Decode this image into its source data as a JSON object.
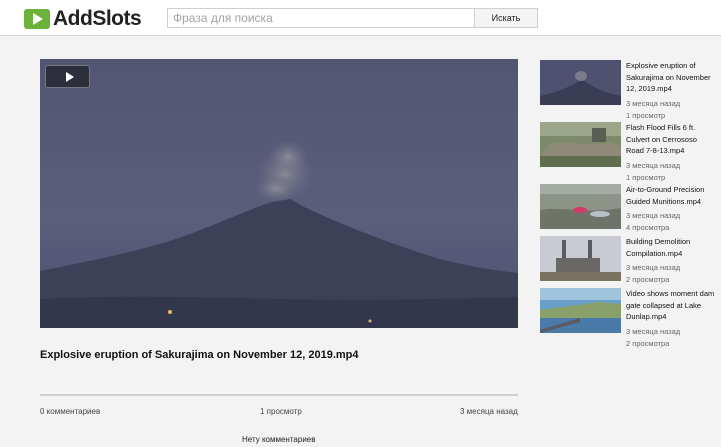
{
  "header": {
    "logo_text": "AddSlots",
    "search_placeholder": "Фраза для поиска",
    "search_button": "Искать"
  },
  "video": {
    "title": "Explosive eruption of Sakurajima on November 12, 2019.mp4",
    "comments": "0 комментариев",
    "views": "1 просмотр",
    "date": "3 месяца назад",
    "no_comments": "Нету комментариев"
  },
  "related": [
    {
      "title": "Explosive eruption of Sakurajima on November 12, 2019.mp4",
      "date": "3 месяца назад",
      "views": "1 просмотр"
    },
    {
      "title": "Flash Flood Fills 6 ft. Culvert on Cerrososo Road 7-8-13.mp4",
      "date": "3 месяца назад",
      "views": "1 просмотр"
    },
    {
      "title": "Air-to-Ground Precision Guided Munitions.mp4",
      "date": "3 месяца назад",
      "views": "4 просмотра"
    },
    {
      "title": "Building Demolition Compilation.mp4",
      "date": "3 месяца назад",
      "views": "2 просмотра"
    },
    {
      "title": "Video shows moment dam gate collapsed at Lake Dunlap.mp4",
      "date": "3 месяца назад",
      "views": "2 просмотра"
    }
  ]
}
